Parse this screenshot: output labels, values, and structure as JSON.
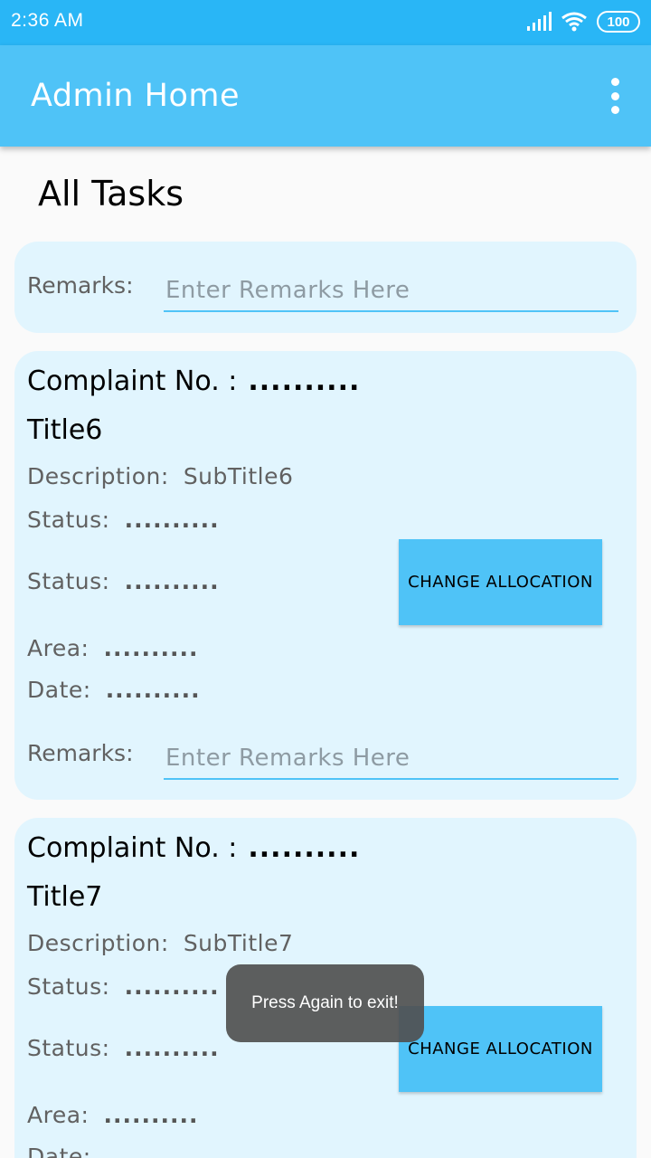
{
  "status_bar": {
    "time": "2:36 AM",
    "battery": "100"
  },
  "app_bar": {
    "title": "Admin Home"
  },
  "section": {
    "title": "All Tasks"
  },
  "remarks": {
    "label": "Remarks:",
    "placeholder": "Enter Remarks Here"
  },
  "task_labels": {
    "complaint_no": "Complaint No. :",
    "description": "Description:",
    "status": "Status:",
    "area": "Area:",
    "date": "Date:",
    "placeholder_value": "..........",
    "button": "CHANGE ALLOCATION"
  },
  "tasks": [
    {
      "title": "Title6",
      "description": "SubTitle6"
    },
    {
      "title": "Title7",
      "description": "SubTitle7"
    }
  ],
  "toast": "Press Again to exit!"
}
